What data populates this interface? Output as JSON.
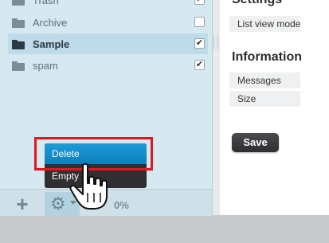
{
  "folders": [
    {
      "label": "Trash",
      "checked": true,
      "selected": false
    },
    {
      "label": "Archive",
      "checked": false,
      "selected": false
    },
    {
      "label": "Sample",
      "checked": true,
      "selected": true
    },
    {
      "label": "spam",
      "checked": true,
      "selected": false
    }
  ],
  "footer": {
    "add_icon": "plus-icon",
    "settings_icon": "gear-icon",
    "quota": "0%"
  },
  "popup_menu": {
    "delete_label": "Delete",
    "empty_label": "Empty"
  },
  "right": {
    "settings_title": "Settings",
    "list_view_mode": "List view mode",
    "info_title": "Information",
    "messages_label": "Messages",
    "size_label": "Size",
    "save_label": "Save"
  },
  "colors": {
    "accent": "#1d9bd8",
    "highlight": "#e0171f",
    "panel": "#d6e8f0"
  }
}
